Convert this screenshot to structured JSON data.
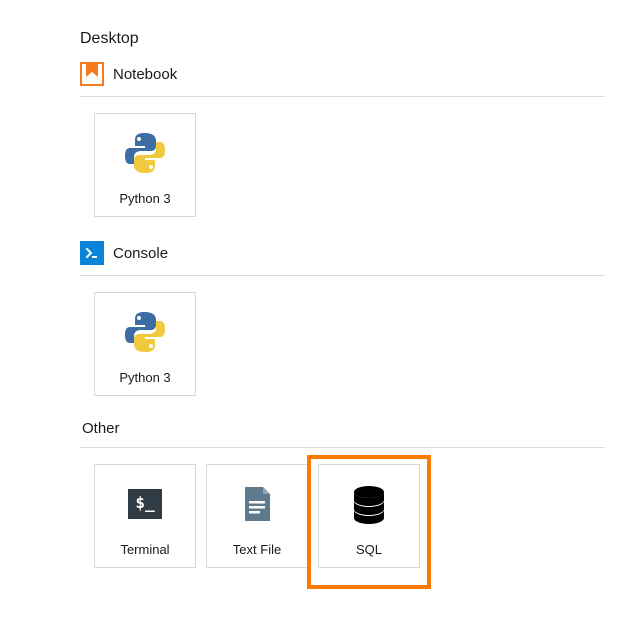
{
  "heading": "Desktop",
  "sections": {
    "notebook": {
      "title": "Notebook",
      "cards": [
        {
          "label": "Python 3"
        }
      ]
    },
    "console": {
      "title": "Console",
      "cards": [
        {
          "label": "Python 3"
        }
      ]
    },
    "other": {
      "title": "Other",
      "cards": [
        {
          "label": "Terminal"
        },
        {
          "label": "Text File"
        },
        {
          "label": "SQL"
        }
      ]
    }
  },
  "colors": {
    "highlight": "#ff7a00",
    "notebook_icon": "#f77a1c",
    "console_icon": "#0a84d6"
  }
}
